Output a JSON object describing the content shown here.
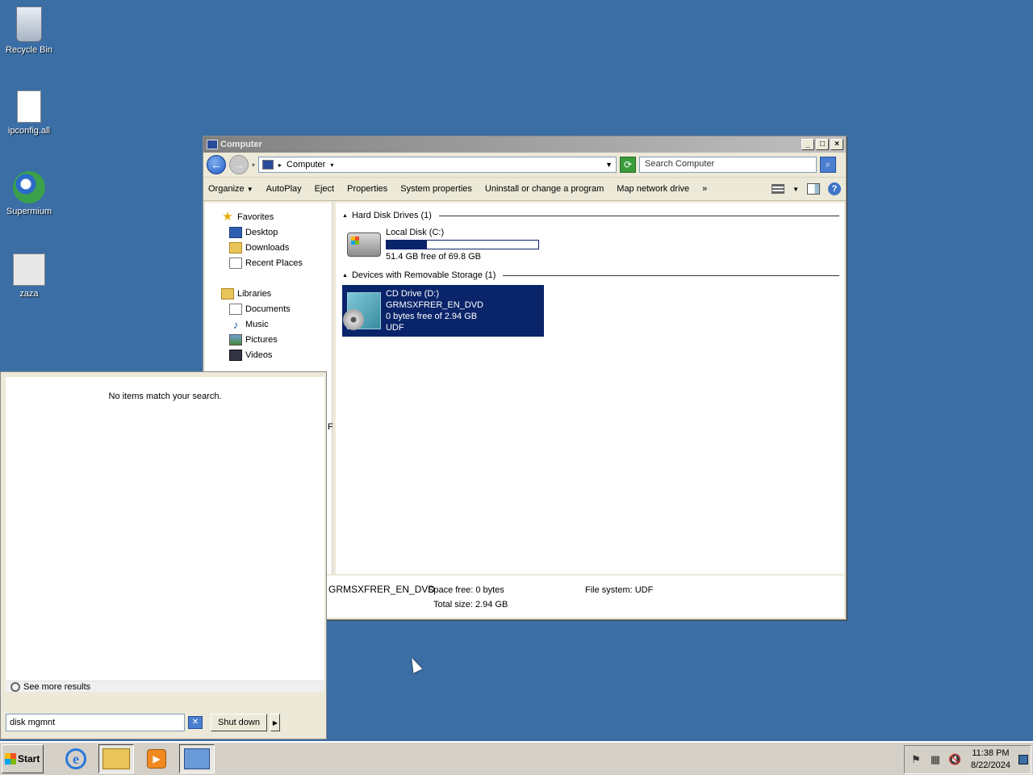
{
  "desktop": {
    "icons": [
      {
        "label": "Recycle Bin",
        "icon": "recycle-bin-icon"
      },
      {
        "label": "ipconfig.all",
        "icon": "text-file-icon"
      },
      {
        "label": "Supermium",
        "icon": "browser-icon"
      },
      {
        "label": "zaza",
        "icon": "settings-gear-icon"
      }
    ]
  },
  "explorer": {
    "title": "Computer",
    "address": "Computer",
    "search_placeholder": "Search Computer",
    "commands": [
      "Organize",
      "AutoPlay",
      "Eject",
      "Properties",
      "System properties",
      "Uninstall or change a program",
      "Map network drive"
    ],
    "more": "»",
    "nav": {
      "favorites": {
        "label": "Favorites",
        "items": [
          "Desktop",
          "Downloads",
          "Recent Places"
        ]
      },
      "libraries": {
        "label": "Libraries",
        "items": [
          "Documents",
          "Music",
          "Pictures",
          "Videos"
        ]
      },
      "truncated_label": "F"
    },
    "groups": [
      {
        "header": "Hard Disk Drives (1)"
      },
      {
        "header": "Devices with Removable Storage (1)"
      }
    ],
    "hdd": {
      "name": "Local Disk (C:)",
      "free": "51.4 GB free of 69.8 GB",
      "used_fraction": 0.264
    },
    "cd": {
      "name": "CD Drive (D:) GRMSXFRER_EN_DVD",
      "free": "0 bytes free of 2.94 GB",
      "fs": "UDF"
    },
    "details": {
      "name": "GRMSXFRER_EN_DVD",
      "space_free": "Space free: 0 bytes",
      "total_size": "Total size: 2.94 GB",
      "file_system": "File system: UDF"
    }
  },
  "startmenu": {
    "no_items": "No items match your search.",
    "see_more": "See more results",
    "search_value": "disk mgmnt",
    "shutdown": "Shut down"
  },
  "taskbar": {
    "start": "Start",
    "time": "11:38 PM",
    "date": "8/22/2024"
  }
}
